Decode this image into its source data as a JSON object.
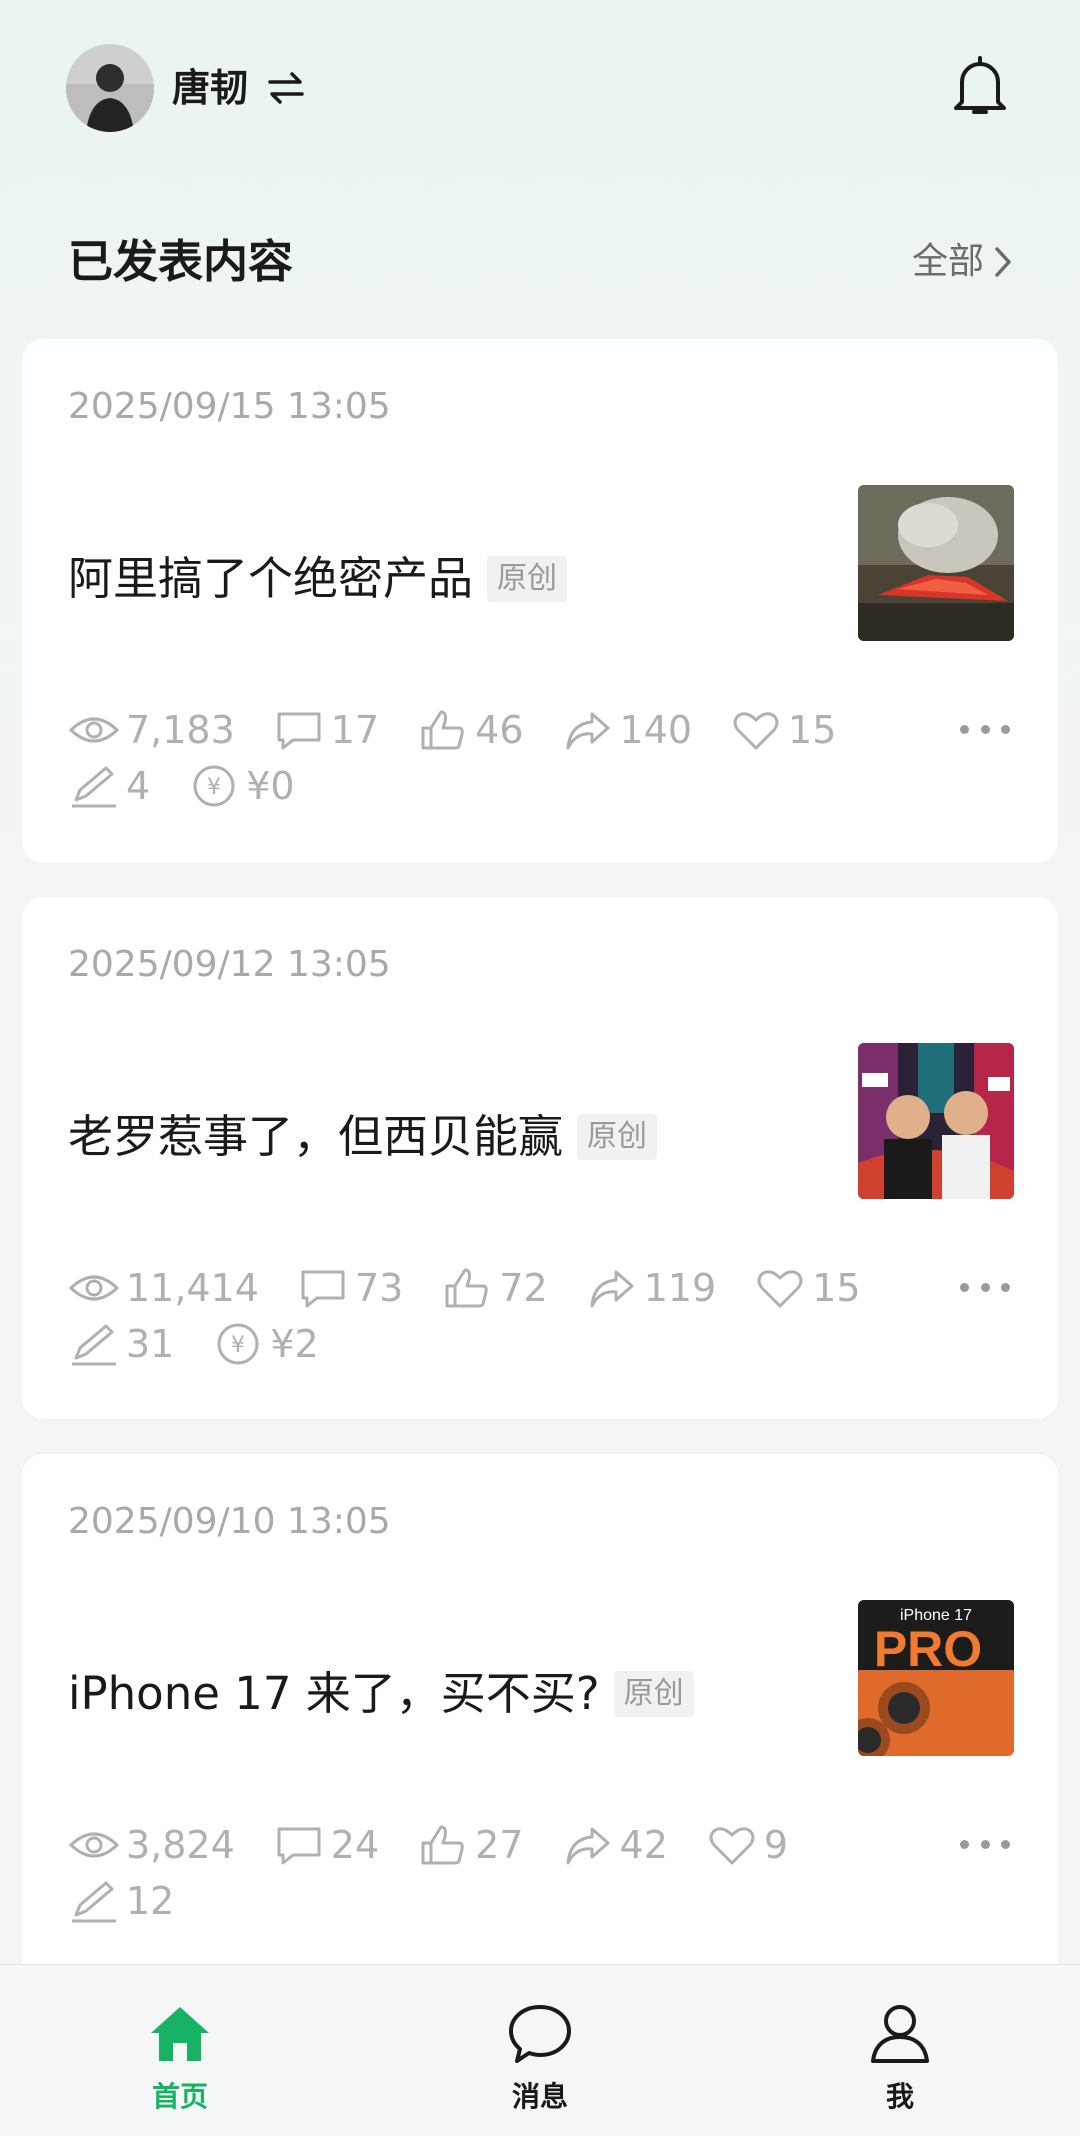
{
  "header": {
    "username": "唐韧",
    "switch_icon": "⇋",
    "bell_icon": "bell-icon"
  },
  "section": {
    "title": "已发表内容",
    "all_link": "全部"
  },
  "posts": [
    {
      "date": "2025/09/15 13:05",
      "title": "阿里搞了个绝密产品",
      "badge": "原创",
      "views": "7,183",
      "comments": "17",
      "likes": "46",
      "shares": "140",
      "favorites": "15",
      "edits": "4",
      "earnings": "¥0"
    },
    {
      "date": "2025/09/12 13:05",
      "title": "老罗惹事了，但西贝能赢",
      "badge": "原创",
      "views": "11,414",
      "comments": "73",
      "likes": "72",
      "shares": "119",
      "favorites": "15",
      "edits": "31",
      "earnings": "¥2"
    },
    {
      "date": "2025/09/10 13:05",
      "title": "iPhone 17 来了，买不买?",
      "badge": "原创",
      "views": "3,824",
      "comments": "24",
      "likes": "27",
      "shares": "42",
      "favorites": "9",
      "edits": "12",
      "thumb_text_top": "iPhone 17",
      "thumb_text_big": "PRO"
    }
  ],
  "tabbar": {
    "home": "首页",
    "messages": "消息",
    "me": "我"
  },
  "colors": {
    "accent": "#17b365",
    "stat_gray": "#b0b0b0"
  }
}
